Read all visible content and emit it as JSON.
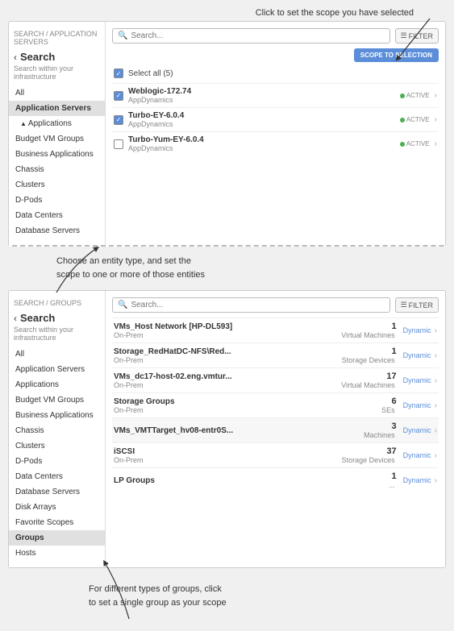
{
  "page": {
    "annotation_top": "Click to set the scope you have selected",
    "annotation_bottom_1": "Choose an entity type, and set the\nscope to one or more of those entities",
    "annotation_bottom_2": "For different types of groups, click\nto set a single group as your scope"
  },
  "panel1": {
    "breadcrumb": "SEARCH / APPLICATION SERVERS",
    "back_label": "< Search",
    "subtitle": "Search within your infrastructure",
    "search_placeholder": "Search...",
    "filter_label": "FILTER",
    "scope_button": "SCOPE TO SELECTION",
    "select_all": "Select all (5)",
    "sidebar_items": [
      {
        "label": "All",
        "active": false,
        "indent": false
      },
      {
        "label": "Application Servers",
        "active": true,
        "indent": false
      },
      {
        "label": "Applications",
        "active": false,
        "indent": true
      },
      {
        "label": "Budget VM Groups",
        "active": false,
        "indent": false
      },
      {
        "label": "Business Applications",
        "active": false,
        "indent": false
      },
      {
        "label": "Chassis",
        "active": false,
        "indent": false
      },
      {
        "label": "Clusters",
        "active": false,
        "indent": false
      },
      {
        "label": "D-Pods",
        "active": false,
        "indent": false
      },
      {
        "label": "Data Centers",
        "active": false,
        "indent": false
      },
      {
        "label": "Database Servers",
        "active": false,
        "indent": false
      }
    ],
    "list_items": [
      {
        "checked": true,
        "name": "Weblogic-172.74",
        "sub": "AppDynamics",
        "status": "ACTIVE"
      },
      {
        "checked": true,
        "name": "Turbo-EY-6.0.4",
        "sub": "AppDynamics",
        "status": "ACTIVE"
      },
      {
        "checked": false,
        "name": "Turbo-Yum-EY-6.0.4",
        "sub": "AppDynamics",
        "status": "ACTIVE"
      }
    ]
  },
  "panel2": {
    "breadcrumb": "SEARCH / GROUPS",
    "back_label": "< Search",
    "subtitle": "Search within your infrastructure",
    "search_placeholder": "Search...",
    "filter_label": "FILTER",
    "sidebar_items": [
      {
        "label": "All",
        "active": false,
        "indent": false
      },
      {
        "label": "Application Servers",
        "active": false,
        "indent": false
      },
      {
        "label": "Applications",
        "active": false,
        "indent": false
      },
      {
        "label": "Budget VM Groups",
        "active": false,
        "indent": false
      },
      {
        "label": "Business Applications",
        "active": false,
        "indent": false
      },
      {
        "label": "Chassis",
        "active": false,
        "indent": false
      },
      {
        "label": "Clusters",
        "active": false,
        "indent": false
      },
      {
        "label": "D-Pods",
        "active": false,
        "indent": false
      },
      {
        "label": "Data Centers",
        "active": false,
        "indent": false
      },
      {
        "label": "Database Servers",
        "active": false,
        "indent": false
      },
      {
        "label": "Disk Arrays",
        "active": false,
        "indent": false
      },
      {
        "label": "Favorite Scopes",
        "active": false,
        "indent": false
      },
      {
        "label": "Groups",
        "active": true,
        "indent": false
      },
      {
        "label": "Hosts",
        "active": false,
        "indent": false
      }
    ],
    "group_rows": [
      {
        "name": "VMs_Host Network [HP-DL593]",
        "sub_location": "On-Prem",
        "count": "1",
        "type": "Virtual Machines",
        "badge": "Dynamic"
      },
      {
        "name": "Storage_RedHatDC-NFS\\Red...",
        "sub_location": "On-Prem",
        "count": "1",
        "type": "Storage Devices",
        "badge": "Dynamic"
      },
      {
        "name": "VMs_dc17-host-02.eng.vmtur...",
        "sub_location": "On-Prem",
        "count": "17",
        "type": "Virtual Machines",
        "badge": "Dynamic"
      },
      {
        "name": "Storage Groups",
        "sub_location": "On-Prem",
        "count": "6",
        "type": "SEs",
        "badge": "Dynamic"
      },
      {
        "name": "VMs_VMTTarget_hv08-entr0S...",
        "sub_location": "",
        "count": "3",
        "type": "Machines",
        "badge": "Dynamic"
      },
      {
        "name": "iSCSI",
        "sub_location": "On-Prem",
        "count": "37",
        "type": "Storage Devices",
        "badge": "Dynamic"
      },
      {
        "name": "LP Groups",
        "sub_location": "",
        "count": "1",
        "type": "...",
        "badge": "Dynamic"
      }
    ]
  }
}
